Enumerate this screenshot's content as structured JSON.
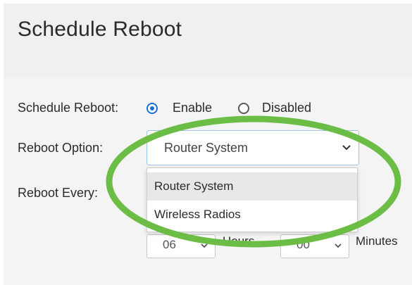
{
  "page": {
    "title": "Schedule Reboot"
  },
  "form": {
    "schedule_reboot": {
      "label": "Schedule Reboot:",
      "options": [
        {
          "label": "Enable",
          "selected": true
        },
        {
          "label": "Disabled",
          "selected": false
        }
      ]
    },
    "reboot_option": {
      "label": "Reboot Option:",
      "value": "Router System",
      "dropdown_open": true,
      "options": [
        "Router System",
        "Wireless Radios"
      ],
      "highlighted": "Router System"
    },
    "reboot_every": {
      "label": "Reboot Every:",
      "hours_value": "06",
      "hours_unit": "Hours",
      "minutes_value": "00",
      "minutes_unit": "Minutes"
    }
  },
  "annotation": {
    "highlight_color": "#6cbd45"
  },
  "icons": {
    "select_chevron": "chevron-down-icon"
  },
  "colors": {
    "accent": "#1a6fd1",
    "header_bg": "#f0f0f1",
    "content_bg": "#f4f4f5"
  }
}
